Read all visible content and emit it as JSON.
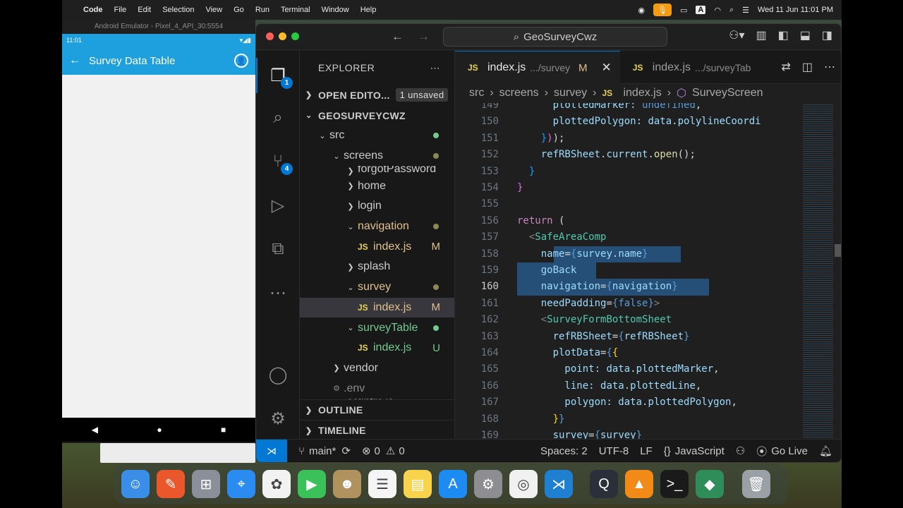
{
  "menubar": {
    "app": "Code",
    "items": [
      "File",
      "Edit",
      "Selection",
      "View",
      "Go",
      "Run",
      "Terminal",
      "Window",
      "Help"
    ],
    "clock": "Wed 11 Jun  11:01 PM"
  },
  "emulator": {
    "title": "Android Emulator - Pixel_4_API_30:5554",
    "time": "11:01",
    "screen_title": "Survey Data Table"
  },
  "vscode": {
    "search": "GeoSurveyCwz",
    "explorer_title": "EXPLORER",
    "open_editors": "OPEN EDITO...",
    "unsaved": "1 unsaved",
    "project": "GEOSURVEYCWZ",
    "outline": "OUTLINE",
    "timeline": "TIMELINE",
    "badges": {
      "explorer": "1",
      "scm": "4"
    }
  },
  "tree": [
    {
      "name": "src",
      "indent": 1,
      "kind": "folder-open",
      "dot": "green"
    },
    {
      "name": "screens",
      "indent": 2,
      "kind": "folder-open",
      "dot": "yellow"
    },
    {
      "name": "forgotPassword",
      "indent": 3,
      "kind": "folder",
      "clipped": true
    },
    {
      "name": "home",
      "indent": 3,
      "kind": "folder"
    },
    {
      "name": "login",
      "indent": 3,
      "kind": "folder"
    },
    {
      "name": "navigation",
      "indent": 3,
      "kind": "folder-open",
      "dot": "yellow",
      "color": "mod"
    },
    {
      "name": "index.js",
      "indent": 4,
      "kind": "js",
      "mark": "M",
      "color": "mod"
    },
    {
      "name": "splash",
      "indent": 3,
      "kind": "folder"
    },
    {
      "name": "survey",
      "indent": 3,
      "kind": "folder-open",
      "dot": "yellow",
      "color": "mod"
    },
    {
      "name": "index.js",
      "indent": 4,
      "kind": "js",
      "mark": "M",
      "color": "mod",
      "selected": true
    },
    {
      "name": "surveyTable",
      "indent": 3,
      "kind": "folder-open",
      "dot": "green",
      "color": "new"
    },
    {
      "name": "index.js",
      "indent": 4,
      "kind": "js",
      "mark": "U",
      "color": "new"
    },
    {
      "name": "vendor",
      "indent": 2,
      "kind": "folder"
    },
    {
      "name": ".env",
      "indent": 2,
      "kind": "gear"
    },
    {
      "name": ".eslintrc.js",
      "indent": 2,
      "kind": "file",
      "clipped": true
    }
  ],
  "tabs": [
    {
      "file": "index.js",
      "path": ".../survey",
      "mark": "M",
      "active": true
    },
    {
      "file": "index.js",
      "path": ".../surveyTab",
      "active": false
    }
  ],
  "breadcrumbs": [
    "src",
    "screens",
    "survey",
    "index.js",
    "SurveyScreen"
  ],
  "code_lines": [
    {
      "n": 149,
      "tokens": [
        [
          "      plottedMarker: ",
          "attr"
        ],
        [
          "undefined",
          "br"
        ],
        [
          ",",
          "c"
        ]
      ]
    },
    {
      "n": 150,
      "tokens": [
        [
          "      plottedPolygon: ",
          "attr"
        ],
        [
          "data",
          "attr"
        ],
        [
          ".",
          "c"
        ],
        [
          "polylineCoordi",
          "attr"
        ]
      ]
    },
    {
      "n": 151,
      "tokens": [
        [
          "    ",
          "c"
        ],
        [
          "}",
          "b"
        ],
        [
          ")",
          "p"
        ],
        [
          ");",
          "c"
        ]
      ]
    },
    {
      "n": 152,
      "tokens": [
        [
          "    refRBSheet",
          "attr"
        ],
        [
          ".",
          "c"
        ],
        [
          "current",
          "attr"
        ],
        [
          ".",
          "c"
        ],
        [
          "open",
          "fn"
        ],
        [
          "();",
          "c"
        ]
      ]
    },
    {
      "n": 153,
      "tokens": [
        [
          "  }",
          "b"
        ]
      ]
    },
    {
      "n": 154,
      "tokens": [
        [
          "}",
          "p"
        ]
      ]
    },
    {
      "n": 155,
      "tokens": []
    },
    {
      "n": 156,
      "tokens": [
        [
          "return",
          "kw"
        ],
        [
          " (",
          "c"
        ]
      ]
    },
    {
      "n": 157,
      "tokens": [
        [
          "  <",
          "pun"
        ],
        [
          "SafeAreaComp",
          "tag"
        ]
      ]
    },
    {
      "n": 158,
      "tokens": [
        [
          "    name",
          "attr"
        ],
        [
          "=",
          "c"
        ],
        [
          "{",
          "br"
        ],
        [
          "survey",
          "attr"
        ],
        [
          ".",
          "c"
        ],
        [
          "name",
          "attr"
        ],
        [
          "}",
          "br"
        ]
      ]
    },
    {
      "n": 159,
      "tokens": [
        [
          "    goBack",
          "attr"
        ]
      ]
    },
    {
      "n": 160,
      "tokens": [
        [
          "    navigation",
          "attr"
        ],
        [
          "=",
          "c"
        ],
        [
          "{",
          "br"
        ],
        [
          "navigation",
          "attr"
        ],
        [
          "}",
          "br"
        ]
      ]
    },
    {
      "n": 161,
      "tokens": [
        [
          "    needPadding",
          "attr"
        ],
        [
          "=",
          "c"
        ],
        [
          "{",
          "br"
        ],
        [
          "false",
          "br"
        ],
        [
          "}",
          "br"
        ],
        [
          ">",
          "pun"
        ]
      ]
    },
    {
      "n": 162,
      "tokens": [
        [
          "    <",
          "pun"
        ],
        [
          "SurveyFormBottomSheet",
          "tag"
        ]
      ]
    },
    {
      "n": 163,
      "tokens": [
        [
          "      refRBSheet",
          "attr"
        ],
        [
          "=",
          "c"
        ],
        [
          "{",
          "br"
        ],
        [
          "refRBSheet",
          "attr"
        ],
        [
          "}",
          "br"
        ]
      ]
    },
    {
      "n": 164,
      "tokens": [
        [
          "      plotData",
          "attr"
        ],
        [
          "=",
          "c"
        ],
        [
          "{",
          "br"
        ],
        [
          "{",
          "y"
        ]
      ]
    },
    {
      "n": 165,
      "tokens": [
        [
          "        point: ",
          "attr"
        ],
        [
          "data",
          "attr"
        ],
        [
          ".",
          "c"
        ],
        [
          "plottedMarker",
          "attr"
        ],
        [
          ",",
          "c"
        ]
      ]
    },
    {
      "n": 166,
      "tokens": [
        [
          "        line: ",
          "attr"
        ],
        [
          "data",
          "attr"
        ],
        [
          ".",
          "c"
        ],
        [
          "plottedLine",
          "attr"
        ],
        [
          ",",
          "c"
        ]
      ]
    },
    {
      "n": 167,
      "tokens": [
        [
          "        polygon: ",
          "attr"
        ],
        [
          "data",
          "attr"
        ],
        [
          ".",
          "c"
        ],
        [
          "plottedPolygon",
          "attr"
        ],
        [
          ",",
          "c"
        ]
      ]
    },
    {
      "n": 168,
      "tokens": [
        [
          "      ",
          "c"
        ],
        [
          "}",
          "y"
        ],
        [
          "}",
          "br"
        ]
      ]
    },
    {
      "n": 169,
      "tokens": [
        [
          "      survey",
          "attr"
        ],
        [
          "=",
          "c"
        ],
        [
          "{",
          "br"
        ],
        [
          "survey",
          "attr"
        ],
        [
          "}",
          "br"
        ]
      ]
    }
  ],
  "status": {
    "branch": "main*",
    "problems": "0",
    "warnings": "0",
    "spaces": "Spaces: 2",
    "encoding": "UTF-8",
    "eol": "LF",
    "language": "JavaScript",
    "golive": "Go Live"
  },
  "dock_apps": [
    "finder-icon",
    "pen-icon",
    "launchpad-icon",
    "safari-icon",
    "photos-icon",
    "facetime-icon",
    "contacts-icon",
    "reminders-icon",
    "notes-icon",
    "appstore-icon",
    "settings-icon",
    "chrome-icon",
    "vscode-icon",
    "quicktime-icon",
    "vlc-icon",
    "terminal-icon",
    "android-studio-icon",
    "trash-icon"
  ]
}
